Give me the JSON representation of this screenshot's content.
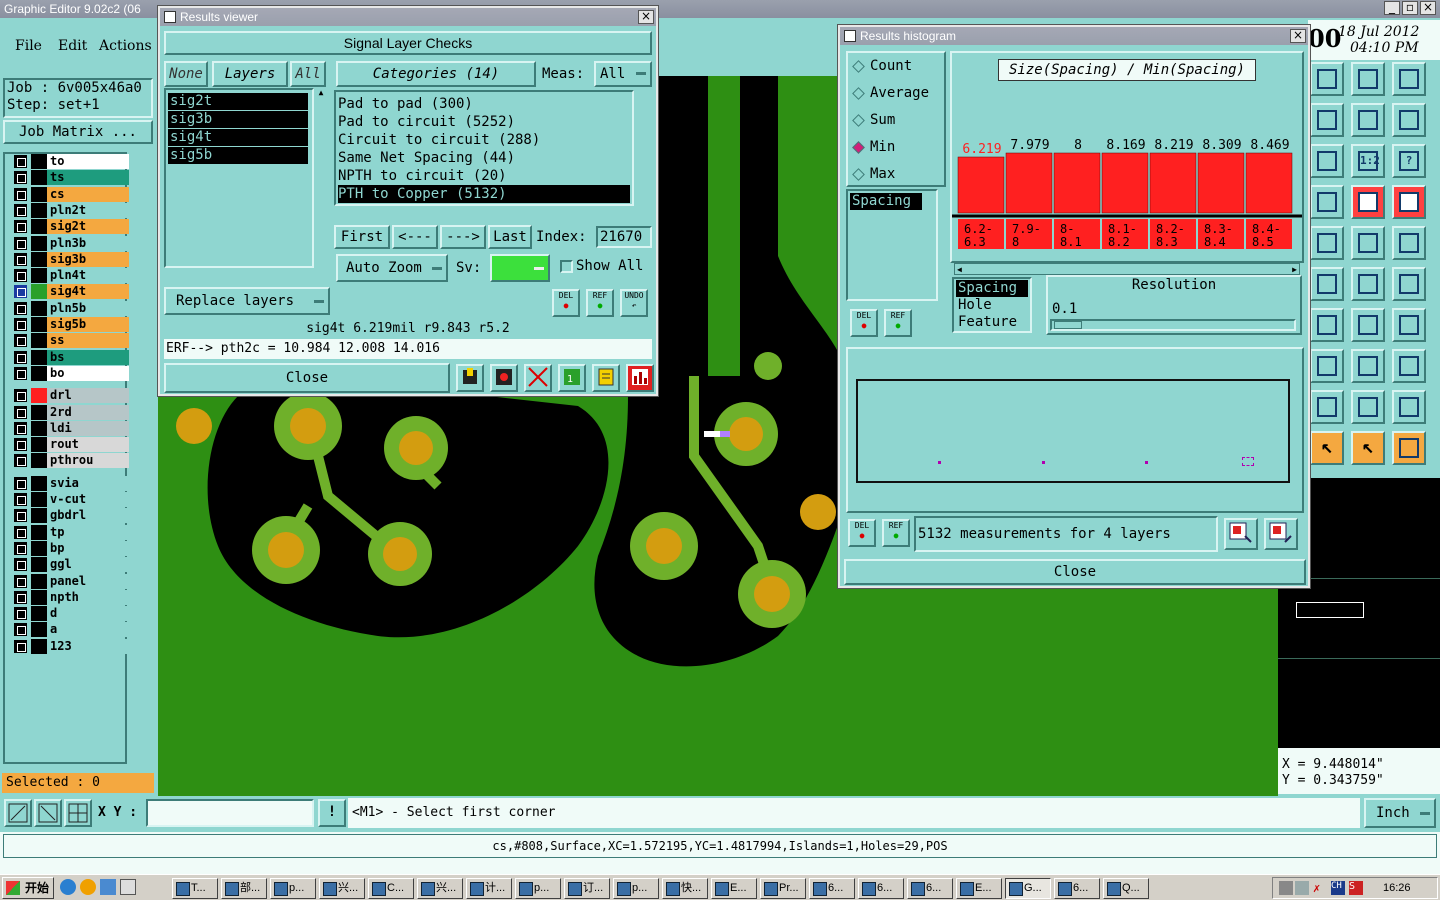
{
  "app": {
    "title": "Graphic Editor 9.02c2 (06"
  },
  "menu": {
    "file": "File",
    "edit": "Edit",
    "actions": "Actions"
  },
  "job": {
    "job_label": "Job : 6v005x46a0",
    "step_label": "Step: set+1",
    "matrix_button": "Job Matrix ..."
  },
  "layers": [
    {
      "name": "to",
      "color": "#ffffff"
    },
    {
      "name": "ts",
      "color": "#1e9c7e"
    },
    {
      "name": "cs",
      "color": "#f4a840"
    },
    {
      "name": "pln2t",
      "color": "#8fd6d0"
    },
    {
      "name": "sig2t",
      "color": "#f4a840"
    },
    {
      "name": "pln3b",
      "color": "#8fd6d0"
    },
    {
      "name": "sig3b",
      "color": "#f4a840"
    },
    {
      "name": "pln4t",
      "color": "#8fd6d0"
    },
    {
      "name": "sig4t",
      "color": "#f4a840"
    },
    {
      "name": "pln5b",
      "color": "#8fd6d0"
    },
    {
      "name": "sig5b",
      "color": "#f4a840"
    },
    {
      "name": "ss",
      "color": "#f4a840"
    },
    {
      "name": "bs",
      "color": "#1e9c7e"
    },
    {
      "name": "bo",
      "color": "#ffffff"
    },
    {
      "name": "drl",
      "color": "#b6c6c8"
    },
    {
      "name": "2rd",
      "color": "#b6c6c8"
    },
    {
      "name": "ldi",
      "color": "#b6c6c8"
    },
    {
      "name": "rout",
      "color": "#d8d8d8"
    },
    {
      "name": "pthrou",
      "color": "#d8d8d8"
    },
    {
      "name": "svia",
      "color": "#8fd6d0"
    },
    {
      "name": "v-cut",
      "color": "#8fd6d0"
    },
    {
      "name": "gbdrl",
      "color": "#8fd6d0"
    },
    {
      "name": "tp",
      "color": "#8fd6d0"
    },
    {
      "name": "bp",
      "color": "#8fd6d0"
    },
    {
      "name": "ggl",
      "color": "#8fd6d0"
    },
    {
      "name": "panel",
      "color": "#8fd6d0"
    },
    {
      "name": "npth",
      "color": "#8fd6d0"
    },
    {
      "name": "d",
      "color": "#8fd6d0"
    },
    {
      "name": "a",
      "color": "#8fd6d0"
    },
    {
      "name": "123",
      "color": "#8fd6d0"
    }
  ],
  "selected": "Selected : 0",
  "date": {
    "line1": "18 Jul 2012",
    "line2": "04:10 PM",
    "prefix": "00"
  },
  "results_viewer": {
    "title": "Results viewer",
    "header": "Signal Layer Checks",
    "none_btn": "None",
    "layers_btn": "Layers",
    "all_btn": "All",
    "categories_btn": "Categories (14)",
    "meas_label": "Meas:",
    "meas_value": "All",
    "layer_list": [
      "sig2t",
      "sig3b",
      "sig4t",
      "sig5b"
    ],
    "categories": [
      "Pad to pad (300)",
      "Pad to circuit (5252)",
      "Circuit to circuit (288)",
      "Same Net Spacing (44)",
      "NPTH to circuit (20)",
      "PTH to Copper (5132)"
    ],
    "first": "First",
    "prev": "<---",
    "next": "--->",
    "last": "Last",
    "index_label": "Index:",
    "index_value": "21670",
    "auto_zoom": "Auto Zoom",
    "sv_label": "Sv:",
    "show_all": "Show All",
    "replace_layers": "Replace layers",
    "del": "DEL",
    "ref": "REF",
    "undo": "UNDO",
    "info_line": "sig4t 6.219mil  r9.843  r5.2",
    "erf_line": "ERF--> pth2c = 10.984 12.008 14.016",
    "close": "Close"
  },
  "histogram": {
    "title": "Results histogram",
    "options": [
      "Count",
      "Average",
      "Sum",
      "Min",
      "Max"
    ],
    "selected_option": "Min",
    "chart_title": "Size(Spacing) / Min(Spacing)",
    "measure_list": [
      "Spacing"
    ],
    "del": "DEL",
    "ref": "REF",
    "attribute_list": [
      "Spacing",
      "Hole",
      "Feature"
    ],
    "resolution_label": "Resolution",
    "resolution_value": "0.1",
    "measurements_text": "5132 measurements for 4 layers",
    "close": "Close"
  },
  "chart_data": {
    "type": "bar",
    "title": "Size(Spacing) / Min(Spacing)",
    "categories": [
      "6.2-6.3",
      "7.9-8",
      "8-8.1",
      "8.1-8.2",
      "8.2-8.3",
      "8.3-8.4",
      "8.4-8.5"
    ],
    "values": [
      6.219,
      7.979,
      8,
      8.169,
      8.219,
      8.309,
      8.469
    ],
    "labels": [
      "6.219",
      "7.979",
      "8",
      "8.169",
      "8.219",
      "8.309",
      "8.469"
    ],
    "category_parts": [
      [
        "6.2-",
        "6.3"
      ],
      [
        "7.9-",
        "8"
      ],
      [
        "8-",
        "8.1"
      ],
      [
        "8.1-",
        "8.2"
      ],
      [
        "8.2-",
        "8.3"
      ],
      [
        "8.3-",
        "8.4"
      ],
      [
        "8.4-",
        "8.5"
      ]
    ],
    "highlight_index": 0,
    "bar_color": "#ff2020",
    "highlight_label_color": "#ff2020",
    "label_color": "#000000"
  },
  "coords": {
    "x": "X = 9.448014\"",
    "y": "Y = 0.343759\""
  },
  "status": {
    "xy_label": "X Y :",
    "prompt": "<M1> - Select first corner",
    "units": "Inch"
  },
  "info": "cs,#808,Surface,XC=1.572195,YC=1.4817994,Islands=1,Holes=29,POS",
  "taskbar": {
    "start": "开始",
    "clock": "16:26",
    "items": [
      "T...",
      "部...",
      "p...",
      "兴...",
      "C...",
      "兴...",
      "计...",
      "p...",
      "订...",
      "p...",
      "快...",
      "E...",
      "Pr...",
      "6...",
      "6...",
      "6...",
      "E...",
      "G...",
      "6...",
      "Q..."
    ]
  },
  "colors": {
    "panel": "#8fd6d0",
    "board_green": "#2e8f13",
    "copper": "#6fb02a",
    "pad": "#d39d10"
  }
}
